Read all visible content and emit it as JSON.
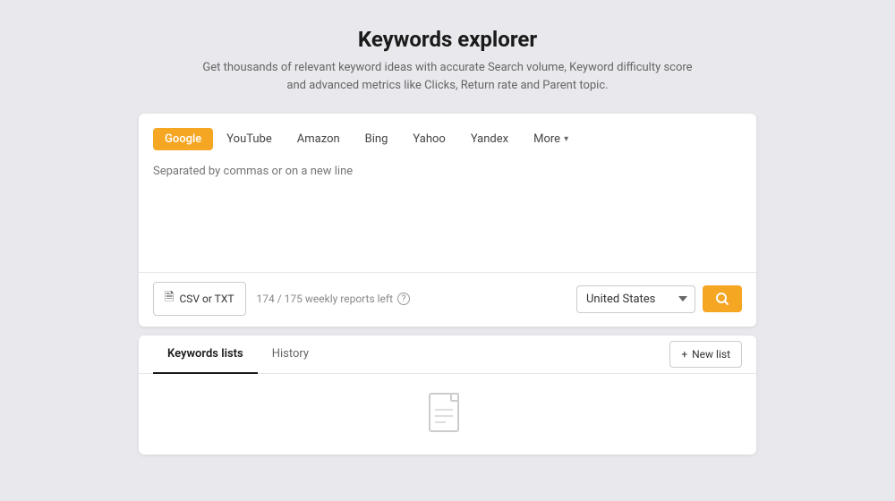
{
  "header": {
    "title": "Keywords explorer",
    "subtitle": "Get thousands of relevant keyword ideas with accurate Search volume, Keyword difficulty score and advanced metrics like Clicks, Return rate and Parent topic."
  },
  "search_tabs": {
    "items": [
      {
        "label": "Google",
        "active": true
      },
      {
        "label": "YouTube",
        "active": false
      },
      {
        "label": "Amazon",
        "active": false
      },
      {
        "label": "Bing",
        "active": false
      },
      {
        "label": "Yahoo",
        "active": false
      },
      {
        "label": "Yandex",
        "active": false
      },
      {
        "label": "More",
        "active": false
      }
    ]
  },
  "textarea": {
    "placeholder": "Separated by commas or on a new line"
  },
  "footer": {
    "csv_label": "CSV or TXT",
    "reports_text": "174 / 175 weekly reports left",
    "country": "United States",
    "search_icon": "search-icon"
  },
  "bottom_section": {
    "tabs": [
      {
        "label": "Keywords lists",
        "active": true
      },
      {
        "label": "History",
        "active": false
      }
    ],
    "new_list_label": "New list"
  },
  "colors": {
    "active_tab_bg": "#f5a623",
    "search_btn_bg": "#f5a623"
  }
}
